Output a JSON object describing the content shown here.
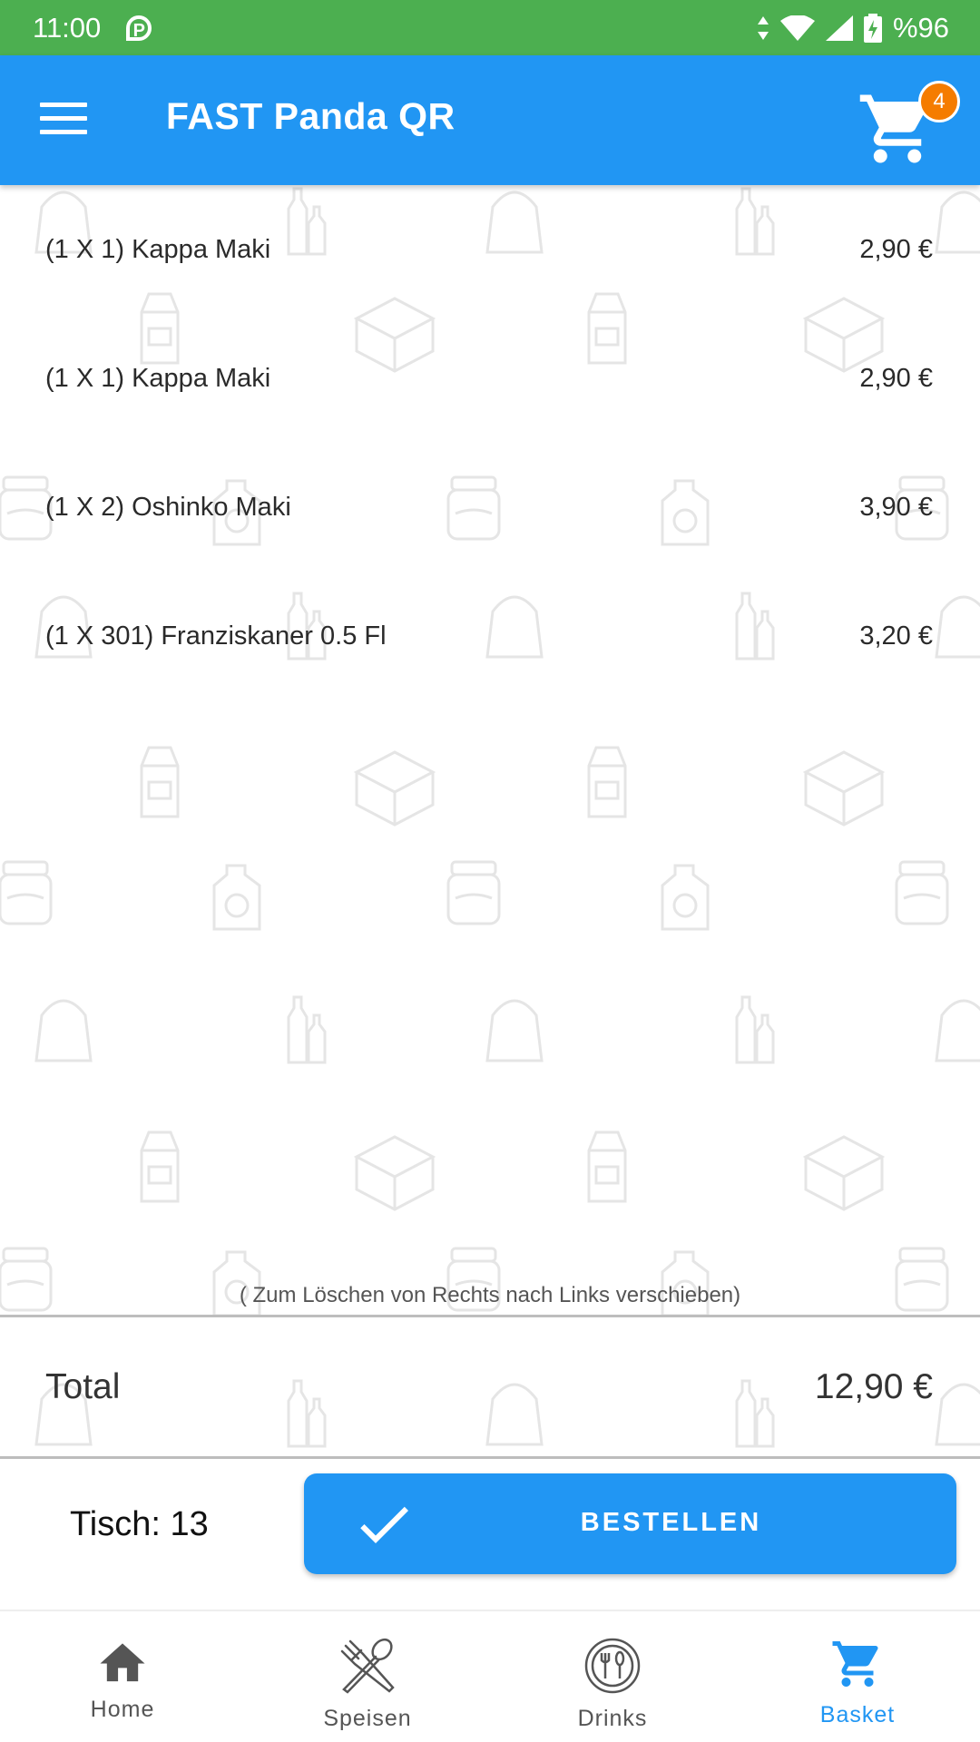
{
  "status_bar": {
    "time": "11:00",
    "app_indicator": "P",
    "battery": "%96",
    "icons": [
      "data-arrows-icon",
      "wifi-icon",
      "signal-icon",
      "battery-charging-icon"
    ]
  },
  "app_bar": {
    "title": "FAST Panda QR",
    "cart_count": "4",
    "menu_icon": "hamburger-menu-icon",
    "cart_icon": "shopping-cart-icon"
  },
  "basket": {
    "items": [
      {
        "label": "(1 X 1) Kappa Maki",
        "price": "2,90 €"
      },
      {
        "label": "(1 X 1) Kappa Maki",
        "price": "2,90 €"
      },
      {
        "label": "(1 X 2) Oshinko Maki",
        "price": "3,90 €"
      },
      {
        "label": "(1 X 301) Franziskaner 0.5 Fl",
        "price": "3,20 €"
      }
    ],
    "hint": "( Zum Löschen von Rechts nach Links verschieben)"
  },
  "total": {
    "label": "Total",
    "value": "12,90 €"
  },
  "order": {
    "table_label": "Tisch: 13",
    "button_label": "BESTELLEN"
  },
  "bottom_nav": {
    "items": [
      {
        "label": "Home",
        "icon": "home-icon"
      },
      {
        "label": "Speisen",
        "icon": "fork-spoon-icon"
      },
      {
        "label": "Drinks",
        "icon": "drinks-plate-icon"
      },
      {
        "label": "Basket",
        "icon": "cart-icon"
      }
    ],
    "active": "Basket"
  },
  "colors": {
    "status_bar": "#4caf50",
    "primary": "#2196f3",
    "badge": "#f57c00"
  }
}
